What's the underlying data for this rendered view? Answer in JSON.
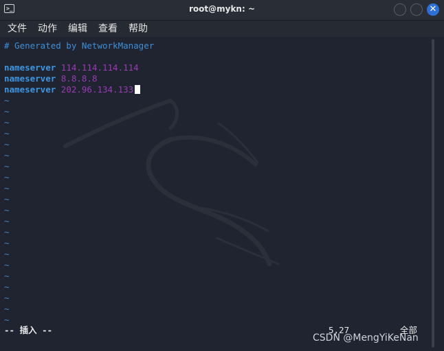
{
  "window": {
    "title": "root@mykn: ~",
    "terminal_icon": "terminal-icon",
    "close_glyph": "✕"
  },
  "menu": [
    {
      "label": "文件"
    },
    {
      "label": "动作"
    },
    {
      "label": "编辑"
    },
    {
      "label": "查看"
    },
    {
      "label": "帮助"
    }
  ],
  "editor": {
    "comment": "# Generated by NetworkManager",
    "nameservers": [
      {
        "keyword": "nameserver",
        "address": "114.114.114.114"
      },
      {
        "keyword": "nameserver",
        "address": "8.8.8.8"
      },
      {
        "keyword": "nameserver",
        "address": "202.96.134.133"
      }
    ],
    "tilde": "~",
    "tilde_count": 21
  },
  "statusline": {
    "mode": "-- 插入 --",
    "position": "5,27",
    "percent": "全部"
  },
  "watermark": "CSDN @MengYiKeNan",
  "colors": {
    "background": "#1f2430",
    "comment": "#3f8fd8",
    "keyword": "#3c96e0",
    "ip": "#9a3cb4",
    "close_button": "#2f6fd8"
  }
}
